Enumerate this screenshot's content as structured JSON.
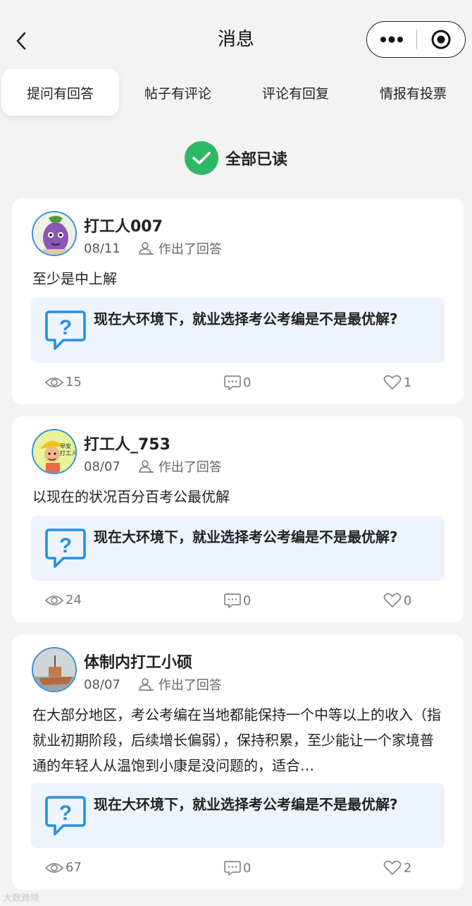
{
  "navbar": {
    "title": "消息"
  },
  "tabs": [
    {
      "label": "提问有回答",
      "active": true
    },
    {
      "label": "帖子有评论",
      "active": false
    },
    {
      "label": "评论有回复",
      "active": false
    },
    {
      "label": "情报有投票",
      "active": false
    }
  ],
  "mark_all_read": {
    "label": "全部已读",
    "color": "#2fb863"
  },
  "messages": [
    {
      "username": "打工人007",
      "date": "08/11",
      "action": "作出了回答",
      "reply": "至少是中上解",
      "question": "现在大环境下，就业选择考公考编是不是最优解?",
      "views": "15",
      "comments": "0",
      "likes": "1"
    },
    {
      "username": "打工人_753",
      "date": "08/07",
      "action": "作出了回答",
      "reply": "以现在的状况百分百考公最优解",
      "question": "现在大环境下，就业选择考公考编是不是最优解?",
      "views": "24",
      "comments": "0",
      "likes": "0",
      "avatar_text": "早安\n打工人"
    },
    {
      "username": "体制内打工小硕",
      "date": "08/07",
      "action": "作出了回答",
      "reply": "在大部分地区，考公考编在当地都能保持一个中等以上的收入（指就业初期阶段，后续增长偏弱），保持积累，至少能让一个家境普通的年轻人从温饱到小康是没问题的，适合…",
      "question": "现在大环境下，就业选择考公考编是不是最优解?",
      "views": "67",
      "comments": "0",
      "likes": "2"
    }
  ],
  "watermark": "大数跨境",
  "colors": {
    "accent_blue": "#2a8fe0",
    "question_bg": "#edf4fd",
    "page_bg": "#f3f3f3"
  }
}
